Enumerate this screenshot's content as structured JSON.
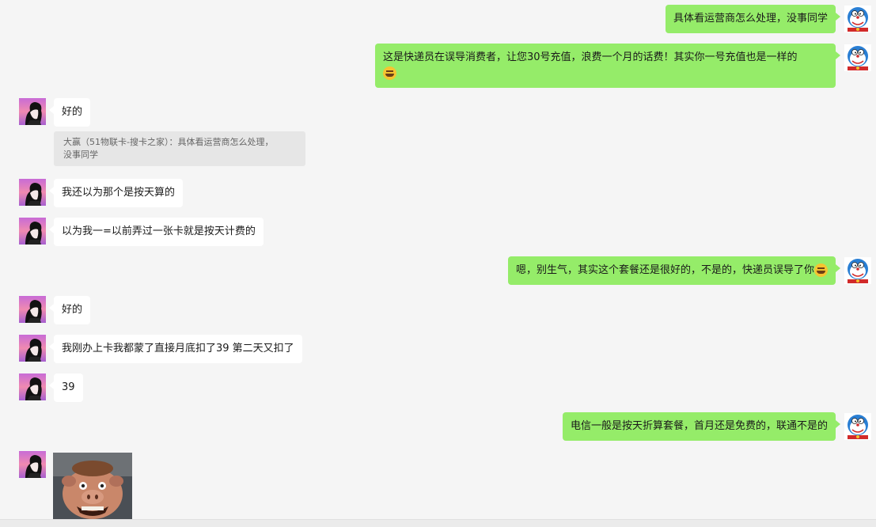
{
  "messages": [
    {
      "text": "具体看运营商怎么处理，没事同学"
    },
    {
      "text": "这是快递员在误导消费者，让您30号充值，浪费一个月的话费！其实你一号充值也是一样的"
    },
    {
      "text": "好的"
    },
    {
      "quote": "大赢（51物联卡-搜卡之家）：具体看运营商怎么处理，\n没事同学"
    },
    {
      "text": "我还以为那个是按天算的"
    },
    {
      "text": "以为我一=以前弄过一张卡就是按天计费的"
    },
    {
      "text": "嗯，别生气，其实这个套餐还是很好的，不是的，快递员误导了你"
    },
    {
      "text": "好的"
    },
    {
      "text": "我刚办上卡我都蒙了直接月底扣了39 第二天又扣了"
    },
    {
      "text": "39"
    },
    {
      "text": "电信一般是按天折算套餐，首月还是免费的，联通不是的"
    }
  ],
  "colors": {
    "self_bubble": "#95ec69",
    "other_bubble": "#ffffff",
    "background": "#f5f5f5",
    "quote_bg": "#e6e6e6"
  },
  "icons": {
    "emoji": "laughing-tears-emoji",
    "self_avatar": "doraemon-avatar",
    "other_avatar": "anime-boy-avatar"
  }
}
